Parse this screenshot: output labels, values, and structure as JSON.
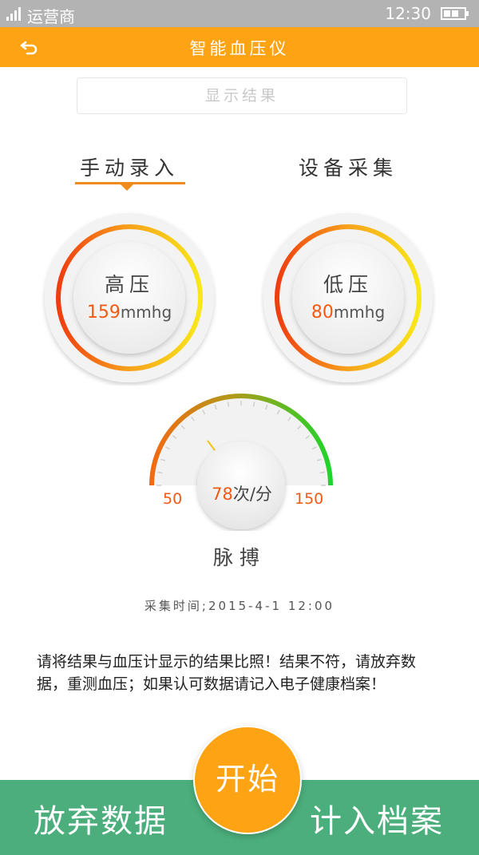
{
  "status_bar": {
    "carrier": "运营商",
    "time": "12:30"
  },
  "header": {
    "title": "智能血压仪"
  },
  "result_box": {
    "label": "显示结果"
  },
  "tabs": [
    {
      "label": "手动录入",
      "active": true
    },
    {
      "label": "设备采集",
      "active": false
    }
  ],
  "high_pressure": {
    "label": "高压",
    "value": "159",
    "unit": "mmhg"
  },
  "low_pressure": {
    "label": "低压",
    "value": "80",
    "unit": "mmhg"
  },
  "pulse": {
    "value": "78",
    "unit": "次/分",
    "min": "50",
    "max": "150",
    "label": "脉搏"
  },
  "collect_time": "采集时间;2015-4-1    12:00",
  "notice": "请将结果与血压计显示的结果比照！结果不符，请放弃数据，重测血压；如果认可数据请记入电子健康档案！",
  "actions": {
    "discard": "放弃数据",
    "start": "开始",
    "record": "计入档案"
  },
  "colors": {
    "orange": "#fea313",
    "green": "#4bae7c",
    "value_red": "#f05a14"
  }
}
